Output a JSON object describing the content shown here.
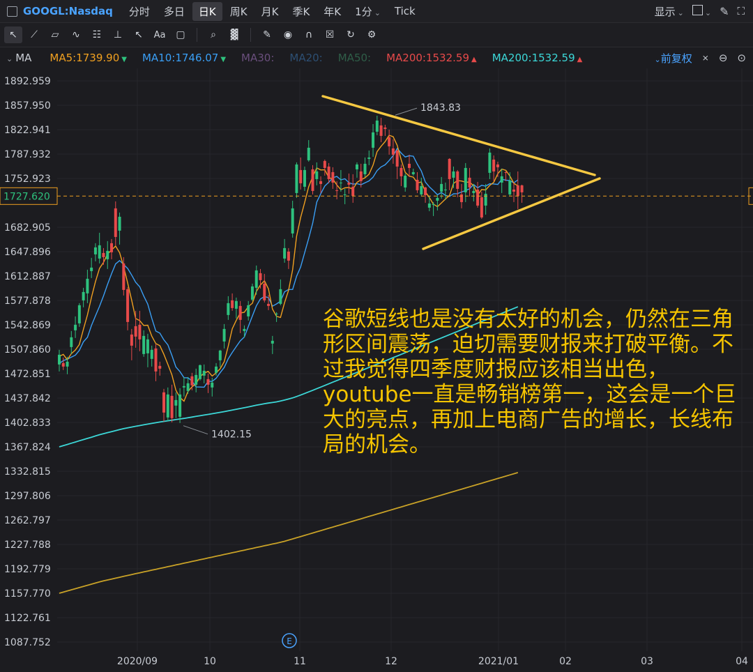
{
  "app": {
    "symbol": "GOOGL:Nasdaq",
    "timeframes": [
      "分时",
      "多日",
      "日K",
      "周K",
      "月K",
      "季K",
      "年K",
      "1分",
      "Tick"
    ],
    "active_timeframe": "日K",
    "display_label": "显示"
  },
  "toolbar": {
    "tools": [
      "cursor-icon",
      "trendline-icon",
      "channel-icon",
      "wave-icon",
      "fib-icon",
      "measure-icon",
      "arrow-icon",
      "text-icon",
      "comment-icon",
      "search-icon",
      "stats-icon",
      "pen-icon",
      "eye-icon",
      "magnet-icon",
      "trash-icon",
      "sync-icon",
      "gear-icon"
    ]
  },
  "ma_bar": {
    "label": "MA",
    "items": [
      {
        "text": "MA5:1739.90",
        "color": "#f0a020",
        "arrow": "▼",
        "arrow_color": "#2ec27e"
      },
      {
        "text": "MA10:1746.07",
        "color": "#3a9ff5",
        "arrow": "▼",
        "arrow_color": "#2ec27e"
      },
      {
        "text": "MA30:",
        "color": "#6a4f7d",
        "arrow": "",
        "arrow_color": ""
      },
      {
        "text": "MA20:",
        "color": "#2d4f73",
        "arrow": "",
        "arrow_color": ""
      },
      {
        "text": "MA50:",
        "color": "#2f5e48",
        "arrow": "",
        "arrow_color": ""
      },
      {
        "text": "MA200:1532.59",
        "color": "#e84a4a",
        "arrow": "▲",
        "arrow_color": "#e84a4a"
      },
      {
        "text": "MA200:1532.59",
        "color": "#3cd8d8",
        "arrow": "▲",
        "arrow_color": "#e84a4a"
      }
    ],
    "adjust_label": "前复权"
  },
  "chart_data": {
    "type": "candlestick",
    "y_ticks": [
      "1892.959",
      "1857.950",
      "1822.941",
      "1787.932",
      "1752.923",
      "1727.620",
      "1682.905",
      "1647.896",
      "1612.887",
      "1577.878",
      "1542.869",
      "1507.860",
      "1472.851",
      "1437.842",
      "1402.833",
      "1367.824",
      "1332.815",
      "1297.806",
      "1262.797",
      "1227.788",
      "1192.779",
      "1157.770",
      "1122.761",
      "1087.752"
    ],
    "x_ticks": [
      "2020/09",
      "10",
      "11",
      "12",
      "2021/01",
      "02",
      "03",
      "04"
    ],
    "current_price": "1727.620",
    "high_label": "1843.83",
    "low_label": "1402.15",
    "ylim": [
      1087.752,
      1892.959
    ],
    "event_marker": "E",
    "candles": [
      [
        1486,
        1500,
        1476,
        1507
      ],
      [
        1488,
        1483,
        1478,
        1496
      ],
      [
        1483,
        1490,
        1472,
        1497
      ],
      [
        1511,
        1525,
        1501,
        1534
      ],
      [
        1535,
        1543,
        1524,
        1555
      ],
      [
        1545,
        1571,
        1540,
        1574
      ],
      [
        1578,
        1590,
        1568,
        1596
      ],
      [
        1588,
        1609,
        1574,
        1622
      ],
      [
        1620,
        1625,
        1610,
        1639
      ],
      [
        1644,
        1654,
        1634,
        1660
      ],
      [
        1638,
        1657,
        1631,
        1675
      ],
      [
        1646,
        1640,
        1629,
        1653
      ],
      [
        1637,
        1649,
        1623,
        1663
      ],
      [
        1660,
        1647,
        1637,
        1666
      ],
      [
        1710,
        1669,
        1657,
        1720
      ],
      [
        1678,
        1698,
        1658,
        1704
      ],
      [
        1631,
        1593,
        1585,
        1640
      ],
      [
        1594,
        1547,
        1535,
        1597
      ],
      [
        1529,
        1513,
        1492,
        1537
      ],
      [
        1541,
        1526,
        1510,
        1563
      ],
      [
        1543,
        1522,
        1505,
        1563
      ],
      [
        1501,
        1527,
        1497,
        1535
      ],
      [
        1502,
        1522,
        1482,
        1530
      ],
      [
        1494,
        1507,
        1483,
        1513
      ],
      [
        1509,
        1476,
        1462,
        1515
      ],
      [
        1484,
        1480,
        1470,
        1490
      ],
      [
        1446,
        1417,
        1404,
        1451
      ],
      [
        1410,
        1443,
        1405,
        1453
      ],
      [
        1441,
        1409,
        1403,
        1457
      ],
      [
        1427,
        1435,
        1409,
        1446
      ],
      [
        1411,
        1443,
        1402,
        1452
      ],
      [
        1453,
        1455,
        1440,
        1468
      ],
      [
        1448,
        1459,
        1444,
        1468
      ],
      [
        1469,
        1456,
        1449,
        1474
      ],
      [
        1457,
        1471,
        1446,
        1480
      ],
      [
        1465,
        1485,
        1463,
        1486
      ],
      [
        1470,
        1477,
        1459,
        1486
      ],
      [
        1465,
        1457,
        1445,
        1473
      ],
      [
        1453,
        1460,
        1440,
        1467
      ],
      [
        1474,
        1483,
        1470,
        1488
      ],
      [
        1492,
        1506,
        1482,
        1507
      ],
      [
        1519,
        1537,
        1509,
        1544
      ],
      [
        1557,
        1574,
        1550,
        1584
      ],
      [
        1578,
        1567,
        1563,
        1588
      ],
      [
        1566,
        1577,
        1552,
        1582
      ],
      [
        1570,
        1550,
        1531,
        1577
      ],
      [
        1534,
        1537,
        1525,
        1542
      ],
      [
        1555,
        1571,
        1549,
        1577
      ],
      [
        1579,
        1598,
        1577,
        1602
      ],
      [
        1596,
        1621,
        1586,
        1628
      ],
      [
        1617,
        1607,
        1595,
        1623
      ],
      [
        1602,
        1578,
        1575,
        1616
      ],
      [
        1573,
        1570,
        1564,
        1586
      ],
      [
        1516,
        1520,
        1501,
        1527
      ],
      [
        1558,
        1559,
        1547,
        1561
      ],
      [
        1573,
        1594,
        1571,
        1608
      ],
      [
        1638,
        1653,
        1632,
        1666
      ],
      [
        1648,
        1635,
        1623,
        1653
      ],
      [
        1674,
        1710,
        1668,
        1721
      ],
      [
        1732,
        1773,
        1725,
        1776
      ],
      [
        1765,
        1746,
        1737,
        1783
      ],
      [
        1741,
        1765,
        1735,
        1770
      ],
      [
        1779,
        1797,
        1777,
        1808
      ],
      [
        1766,
        1735,
        1730,
        1772
      ],
      [
        1752,
        1763,
        1743,
        1776
      ],
      [
        1749,
        1745,
        1732,
        1756
      ],
      [
        1778,
        1768,
        1757,
        1780
      ],
      [
        1770,
        1752,
        1746,
        1775
      ],
      [
        1762,
        1747,
        1738,
        1769
      ],
      [
        1736,
        1735,
        1723,
        1749
      ],
      [
        1747,
        1747,
        1734,
        1765
      ],
      [
        1729,
        1730,
        1716,
        1738
      ],
      [
        1747,
        1744,
        1731,
        1760
      ],
      [
        1741,
        1728,
        1718,
        1759
      ],
      [
        1766,
        1773,
        1754,
        1776
      ],
      [
        1763,
        1749,
        1740,
        1774
      ],
      [
        1759,
        1774,
        1755,
        1783
      ],
      [
        1781,
        1783,
        1772,
        1793
      ],
      [
        1797,
        1819,
        1784,
        1831
      ],
      [
        1820,
        1836,
        1815,
        1843
      ],
      [
        1829,
        1814,
        1805,
        1840
      ],
      [
        1826,
        1824,
        1814,
        1830
      ],
      [
        1812,
        1799,
        1787,
        1823
      ],
      [
        1796,
        1787,
        1774,
        1809
      ],
      [
        1793,
        1770,
        1752,
        1794
      ],
      [
        1768,
        1756,
        1742,
        1773
      ],
      [
        1740,
        1757,
        1734,
        1760
      ],
      [
        1774,
        1768,
        1755,
        1787
      ],
      [
        1759,
        1762,
        1757,
        1767
      ],
      [
        1751,
        1736,
        1732,
        1762
      ],
      [
        1730,
        1742,
        1727,
        1754
      ],
      [
        1740,
        1729,
        1718,
        1741
      ],
      [
        1711,
        1717,
        1706,
        1728
      ],
      [
        1715,
        1716,
        1699,
        1719
      ],
      [
        1721,
        1725,
        1707,
        1729
      ],
      [
        1734,
        1745,
        1724,
        1755
      ],
      [
        1737,
        1737,
        1722,
        1747
      ],
      [
        1781,
        1752,
        1736,
        1782
      ],
      [
        1754,
        1763,
        1739,
        1770
      ],
      [
        1763,
        1738,
        1726,
        1765
      ],
      [
        1730,
        1719,
        1710,
        1745
      ],
      [
        1733,
        1768,
        1719,
        1775
      ],
      [
        1754,
        1740,
        1727,
        1768
      ],
      [
        1732,
        1735,
        1720,
        1745
      ],
      [
        1737,
        1714,
        1711,
        1748
      ],
      [
        1726,
        1697,
        1695,
        1734
      ],
      [
        1714,
        1731,
        1701,
        1745
      ],
      [
        1761,
        1790,
        1752,
        1796
      ],
      [
        1780,
        1763,
        1749,
        1786
      ],
      [
        1773,
        1769,
        1755,
        1777
      ],
      [
        1747,
        1756,
        1732,
        1767
      ],
      [
        1762,
        1761,
        1749,
        1763
      ],
      [
        1730,
        1750,
        1728,
        1762
      ],
      [
        1737,
        1734,
        1719,
        1747
      ],
      [
        1743,
        1728,
        1709,
        1763
      ],
      [
        1743,
        1733,
        1718,
        1744
      ]
    ],
    "ma5": [
      1497.8,
      1500.5,
      1492.9,
      1501.6,
      1506.7,
      1514.8,
      1536.4,
      1557.1,
      1582.4,
      1604.8,
      1623.9,
      1632.5,
      1644.5,
      1650.2,
      1655.9,
      1646.4,
      1626.5,
      1603.0,
      1578.1,
      1552.0,
      1549.0,
      1542.0,
      1542.4,
      1526.7,
      1516.0,
      1513.0,
      1500.7,
      1486.2,
      1471.0,
      1448.9,
      1438.6,
      1433.3,
      1447.3,
      1453.9,
      1458.4,
      1468.6,
      1473.6,
      1476.2,
      1469.5,
      1474.0,
      1479.9,
      1490.0,
      1512.1,
      1537.2,
      1549.5,
      1559.9,
      1560.9,
      1569.2,
      1573.9,
      1590.8,
      1600.2,
      1606.1,
      1594.6,
      1565.5,
      1555.1,
      1553.5,
      1574.6,
      1592.6,
      1621.9,
      1670.0,
      1696.8,
      1718.6,
      1740.9,
      1755.6,
      1768.0,
      1765.1,
      1765.3,
      1754.2,
      1752.1,
      1743.6,
      1736.8,
      1739.5,
      1739.9,
      1737.5,
      1747.3,
      1751.0,
      1753.9,
      1759.0,
      1772.1,
      1791.3,
      1799.1,
      1805.8,
      1814.8,
      1812.8,
      1800.4,
      1779.5,
      1761.6,
      1756.2,
      1754.8,
      1746.5,
      1747.8,
      1733.9,
      1725.6,
      1716.0,
      1712.4,
      1717.8,
      1723.4,
      1728.6,
      1745.8,
      1749.8,
      1749.2,
      1747.6,
      1747.6,
      1742.6,
      1729.0,
      1737.0,
      1736.4,
      1742.9,
      1747.4,
      1759.6,
      1766.4,
      1764.6,
      1756.6,
      1745.9,
      1742.2
    ],
    "ma10": [
      1487.6,
      1491.6,
      1493.7,
      1496.5,
      1499.4,
      1506.3,
      1518.5,
      1525.0,
      1542.0,
      1555.8,
      1569.4,
      1584.5,
      1600.8,
      1616.3,
      1630.3,
      1635.1,
      1629.5,
      1623.8,
      1614.2,
      1603.9,
      1597.5,
      1584.2,
      1572.7,
      1552.3,
      1534.0,
      1531.0,
      1521.4,
      1514.2,
      1498.9,
      1482.4,
      1475.8,
      1467.0,
      1466.8,
      1462.4,
      1453.7,
      1453.6,
      1453.4,
      1461.7,
      1461.7,
      1466.2,
      1474.3,
      1481.8,
      1494.1,
      1503.3,
      1511.8,
      1519.9,
      1525.4,
      1540.6,
      1555.6,
      1570.2,
      1580.0,
      1583.5,
      1581.9,
      1569.7,
      1572.9,
      1576.8,
      1590.3,
      1593.6,
      1593.7,
      1612.6,
      1625.9,
      1646.6,
      1666.7,
      1688.8,
      1719.0,
      1730.9,
      1742.0,
      1747.5,
      1753.9,
      1755.8,
      1750.9,
      1752.4,
      1747.0,
      1744.8,
      1745.4,
      1743.9,
      1746.7,
      1749.4,
      1754.8,
      1764.1,
      1769.5,
      1772.5,
      1778.6,
      1785.7,
      1795.9,
      1789.3,
      1783.7,
      1785.5,
      1784.8,
      1773.5,
      1763.6,
      1747.7,
      1740.9,
      1735.4,
      1729.5,
      1732.8,
      1728.6,
      1727.1,
      1730.9,
      1731.1,
      1733.5,
      1735.5,
      1738.1,
      1744.2,
      1739.4,
      1743.1,
      1741.9,
      1745.3,
      1745.0,
      1744.3,
      1751.7,
      1750.5,
      1749.8,
      1746.6,
      1750.9
    ],
    "ma200": [
      1367.8,
      1369.5,
      1371.2,
      1373.0,
      1374.7,
      1376.5,
      1378.2,
      1379.9,
      1381.6,
      1383.4,
      1385.2,
      1386.7,
      1388.2,
      1389.6,
      1391.1,
      1392.5,
      1393.9,
      1395.1,
      1396.2,
      1397.3,
      1398.3,
      1399.4,
      1400.4,
      1401.4,
      1402.4,
      1403.4,
      1404.3,
      1405.2,
      1406.0,
      1406.9,
      1407.8,
      1408.6,
      1409.6,
      1410.5,
      1411.5,
      1412.4,
      1413.4,
      1414.3,
      1415.3,
      1416.3,
      1417.3,
      1418.3,
      1419.4,
      1420.5,
      1421.7,
      1422.8,
      1423.9,
      1425.1,
      1426.3,
      1427.5,
      1428.6,
      1429.7,
      1430.6,
      1431.4,
      1432.3,
      1433.5,
      1434.9,
      1436.4,
      1438.0,
      1440.0,
      1442.1,
      1444.4,
      1446.6,
      1448.9,
      1451.2,
      1453.5,
      1455.9,
      1458.2,
      1460.6,
      1462.9,
      1465.3,
      1467.6,
      1470.0,
      1472.4,
      1474.7,
      1477.1,
      1479.4,
      1481.8,
      1484.1,
      1486.5,
      1488.8,
      1491.2,
      1493.5,
      1495.9,
      1498.2,
      1500.6,
      1503.0,
      1505.3,
      1507.7,
      1510.0,
      1512.4,
      1514.7,
      1517.1,
      1519.4,
      1521.8,
      1524.1,
      1526.5,
      1528.8,
      1531.2,
      1533.5,
      1535.9,
      1538.2,
      1540.6,
      1543.0,
      1545.3,
      1547.7,
      1550.0,
      1552.4,
      1554.7,
      1557.1,
      1559.4,
      1561.8,
      1564.1,
      1566.5,
      1568.8
    ],
    "ma_long": [
      1157.8,
      1159.4,
      1161.1,
      1162.7,
      1164.3,
      1165.9,
      1167.6,
      1169.2,
      1170.8,
      1172.4,
      1174.1,
      1175.5,
      1176.8,
      1178.1,
      1179.4,
      1180.7,
      1182.0,
      1183.3,
      1184.6,
      1185.9,
      1187.1,
      1188.4,
      1189.6,
      1190.9,
      1192.1,
      1193.4,
      1194.6,
      1195.9,
      1197.1,
      1198.4,
      1199.6,
      1200.9,
      1202.1,
      1203.4,
      1204.6,
      1205.9,
      1207.1,
      1208.4,
      1209.6,
      1210.9,
      1212.1,
      1213.4,
      1214.6,
      1215.9,
      1217.1,
      1218.4,
      1219.6,
      1220.9,
      1222.1,
      1223.4,
      1224.6,
      1225.9,
      1227.1,
      1228.4,
      1229.6,
      1230.9,
      1232.3,
      1234.0,
      1235.7,
      1237.4,
      1239.1,
      1240.8,
      1242.5,
      1244.2,
      1245.9,
      1247.6,
      1249.3,
      1251.0,
      1252.7,
      1254.4,
      1256.1,
      1257.8,
      1259.5,
      1261.2,
      1262.9,
      1264.6,
      1266.3,
      1268.0,
      1269.7,
      1271.4,
      1273.1,
      1274.8,
      1276.5,
      1278.2,
      1279.9,
      1281.6,
      1283.3,
      1285.0,
      1286.7,
      1288.4,
      1290.1,
      1291.8,
      1293.5,
      1295.2,
      1296.9,
      1298.6,
      1300.3,
      1302.0,
      1303.7,
      1305.4,
      1307.1,
      1308.8,
      1310.5,
      1312.2,
      1313.9,
      1315.6,
      1317.3,
      1319.0,
      1320.7,
      1322.4,
      1324.1,
      1325.8,
      1327.5,
      1329.2,
      1330.9
    ]
  },
  "annotation": "谷歌短线也是没有太好的机会，仍然在三角形区间震荡，迫切需要财报来打破平衡。不过我觉得四季度财报应该相当出色，youtube一直是畅销榜第一，这会是一个巨大的亮点，再加上电商广告的增长，长线布局的机会。",
  "colors": {
    "up": "#2ec27e",
    "down": "#e84a4a",
    "ma5": "#f0a020",
    "ma10": "#3a9ff5",
    "ma200": "#3cd8d8",
    "ma_long": "#c9a227",
    "trend": "#f5c842",
    "price_line": "#f0a020"
  }
}
